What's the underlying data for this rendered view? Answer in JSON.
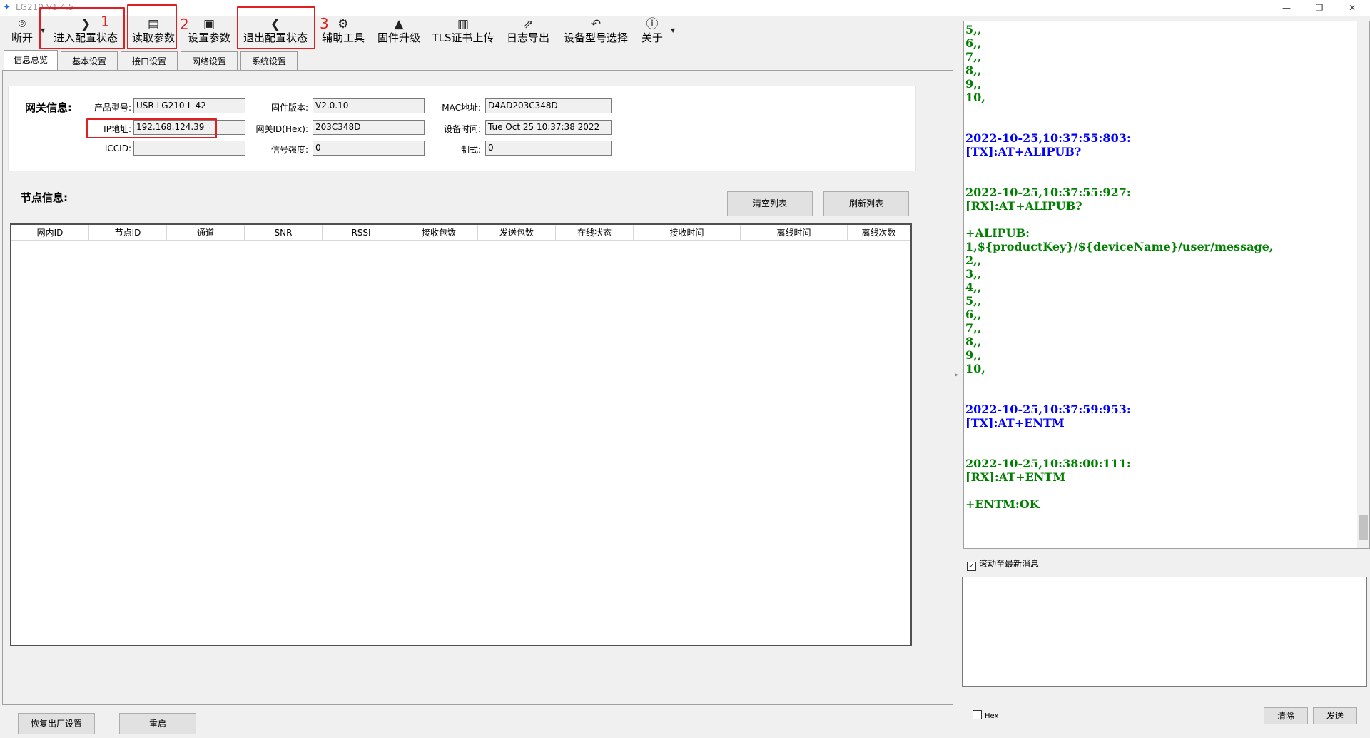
{
  "window": {
    "title": "LG210 V1.4.5",
    "controls": [
      "—",
      "❐",
      "✕"
    ]
  },
  "toolbar": {
    "items": [
      {
        "label": "断开",
        "icon": "location-pin-icon"
      },
      {
        "label": "进入配置状态",
        "icon": "chevron-right-icon"
      },
      {
        "label": "读取参数",
        "icon": "read-document-icon"
      },
      {
        "label": "设置参数",
        "icon": "save-icon"
      },
      {
        "label": "退出配置状态",
        "icon": "chevron-left-icon"
      },
      {
        "label": "辅助工具",
        "icon": "toolbox-icon"
      },
      {
        "label": "固件升级",
        "icon": "rocket-icon"
      },
      {
        "label": "TLS证书上传",
        "icon": "certificate-icon"
      },
      {
        "label": "日志导出",
        "icon": "export-icon"
      },
      {
        "label": "设备型号选择",
        "icon": "undo-arrow-icon"
      },
      {
        "label": "关于",
        "icon": "info-icon"
      }
    ],
    "annotations": [
      "1",
      "2",
      "3"
    ],
    "annotation_color": "#e02020"
  },
  "tabs": [
    "信息总览",
    "基本设置",
    "接口设置",
    "网络设置",
    "系统设置"
  ],
  "gateway": {
    "title": "网关信息:",
    "fields": {
      "model_label": "产品型号:",
      "model": "USR-LG210-L-42",
      "ip_label": "IP地址:",
      "ip": "192.168.124.39",
      "iccid_label": "ICCID:",
      "iccid": "",
      "fw_label": "固件版本:",
      "fw": "V2.0.10",
      "gwid_label": "网关ID(Hex):",
      "gwid": "203C348D",
      "signal_label": "信号强度:",
      "signal": "0",
      "mac_label": "MAC地址:",
      "mac": "D4AD203C348D",
      "time_label": "设备时间:",
      "time": "Tue Oct 25 10:37:38 2022",
      "mode_label": "制式:",
      "mode": "0"
    }
  },
  "nodes": {
    "title": "节点信息:",
    "clear_button": "清空列表",
    "refresh_button": "刷新列表",
    "columns": [
      "网内ID",
      "节点ID",
      "通道",
      "SNR",
      "RSSI",
      "接收包数",
      "发送包数",
      "在线状态",
      "接收时间",
      "离线时间",
      "离线次数"
    ]
  },
  "bottom": {
    "factory_reset": "恢复出厂设置",
    "restart": "重启"
  },
  "log": {
    "colors": {
      "green": "#008000",
      "blue": "#0000ff"
    },
    "lines": [
      {
        "t": "5,,",
        "c": "green"
      },
      {
        "t": "6,,",
        "c": "green"
      },
      {
        "t": "7,,",
        "c": "green"
      },
      {
        "t": "8,,",
        "c": "green"
      },
      {
        "t": "9,,",
        "c": "green"
      },
      {
        "t": "10,",
        "c": "green"
      },
      {
        "t": "",
        "c": "green"
      },
      {
        "t": "",
        "c": "green"
      },
      {
        "t": "2022-10-25,10:37:55:803:",
        "c": "blue"
      },
      {
        "t": "[TX]:AT+ALIPUB?",
        "c": "blue"
      },
      {
        "t": "",
        "c": "green"
      },
      {
        "t": "",
        "c": "green"
      },
      {
        "t": "2022-10-25,10:37:55:927:",
        "c": "green"
      },
      {
        "t": "[RX]:AT+ALIPUB?",
        "c": "green"
      },
      {
        "t": "",
        "c": "green"
      },
      {
        "t": "+ALIPUB:",
        "c": "green"
      },
      {
        "t": "1,${productKey}/${deviceName}/user/message,",
        "c": "green"
      },
      {
        "t": "2,,",
        "c": "green"
      },
      {
        "t": "3,,",
        "c": "green"
      },
      {
        "t": "4,,",
        "c": "green"
      },
      {
        "t": "5,,",
        "c": "green"
      },
      {
        "t": "6,,",
        "c": "green"
      },
      {
        "t": "7,,",
        "c": "green"
      },
      {
        "t": "8,,",
        "c": "green"
      },
      {
        "t": "9,,",
        "c": "green"
      },
      {
        "t": "10,",
        "c": "green"
      },
      {
        "t": "",
        "c": "green"
      },
      {
        "t": "",
        "c": "green"
      },
      {
        "t": "2022-10-25,10:37:59:953:",
        "c": "blue"
      },
      {
        "t": "[TX]:AT+ENTM",
        "c": "blue"
      },
      {
        "t": "",
        "c": "green"
      },
      {
        "t": "",
        "c": "green"
      },
      {
        "t": "2022-10-25,10:38:00:111:",
        "c": "green"
      },
      {
        "t": "[RX]:AT+ENTM",
        "c": "green"
      },
      {
        "t": "",
        "c": "green"
      },
      {
        "t": "+ENTM:OK",
        "c": "green"
      }
    ]
  },
  "log_controls": {
    "autoscroll": "滚动至最新消息",
    "hex": "Hex",
    "clear": "清除",
    "send": "发送"
  }
}
